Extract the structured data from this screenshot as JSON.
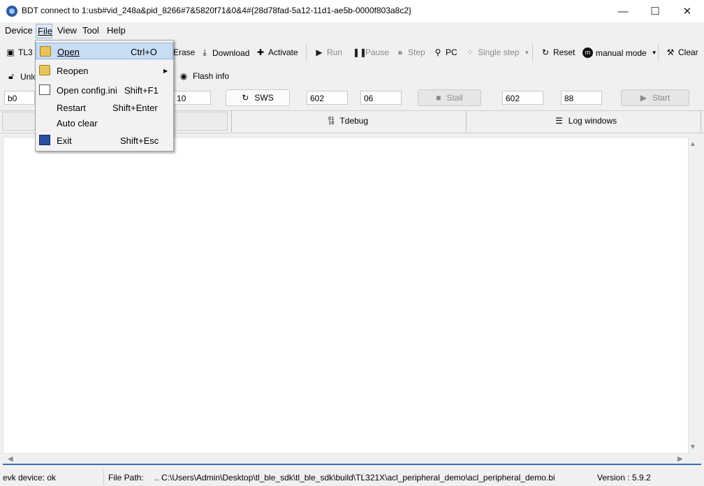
{
  "window": {
    "title": "BDT connect to 1:usb#vid_248a&pid_8266#7&5820f71&0&4#{28d78fad-5a12-11d1-ae5b-0000f803a8c2}",
    "minimize": "—",
    "maximize": "☐",
    "close": "✕"
  },
  "menubar": {
    "device": "Device",
    "file": "File",
    "view": "View",
    "tool": "Tool",
    "help": "Help"
  },
  "toolbar": {
    "chip": "TL3",
    "erase": "Erase",
    "download": "Download",
    "activate": "Activate",
    "run": "Run",
    "pause": "Pause",
    "step": "Step",
    "pc": "PC",
    "single_step": "Single step",
    "reset": "Reset",
    "mode": "manual mode",
    "clear": "Clear"
  },
  "row2": {
    "unlock": "Unlo",
    "flash_info": "Flash info"
  },
  "fields": {
    "f1": "b0",
    "f2": "10",
    "sws": "SWS",
    "f3": "602",
    "f4": "06",
    "stall": "Stall",
    "f5": "602",
    "f6": "88",
    "start": "Start"
  },
  "tabs": {
    "tdebug": "Tdebug",
    "log_windows": "Log windows"
  },
  "statusbar": {
    "device_status": "evk device: ok",
    "file_path_label": "File Path:",
    "file_path_value": "..  C:\\Users\\Admin\\Desktop\\tl_ble_sdk\\tl_ble_sdk\\build\\TL321X\\acl_peripheral_demo\\acl_peripheral_demo.bi",
    "version": "Version : 5.9.2"
  },
  "file_menu": {
    "items": [
      {
        "label": "Open",
        "shortcut": "Ctrl+O"
      },
      {
        "label": "Reopen",
        "shortcut": ""
      },
      {
        "label": "Open config.ini",
        "shortcut": "Shift+F1"
      },
      {
        "label": "Restart",
        "shortcut": "Shift+Enter"
      },
      {
        "label": "Auto clear",
        "shortcut": ""
      },
      {
        "label": "Exit",
        "shortcut": "Shift+Esc"
      }
    ]
  },
  "colors": {
    "accent": "#3b6fb6",
    "menu_highlight": "#c8dcf4",
    "disabled_text": "#8a8a8a"
  }
}
